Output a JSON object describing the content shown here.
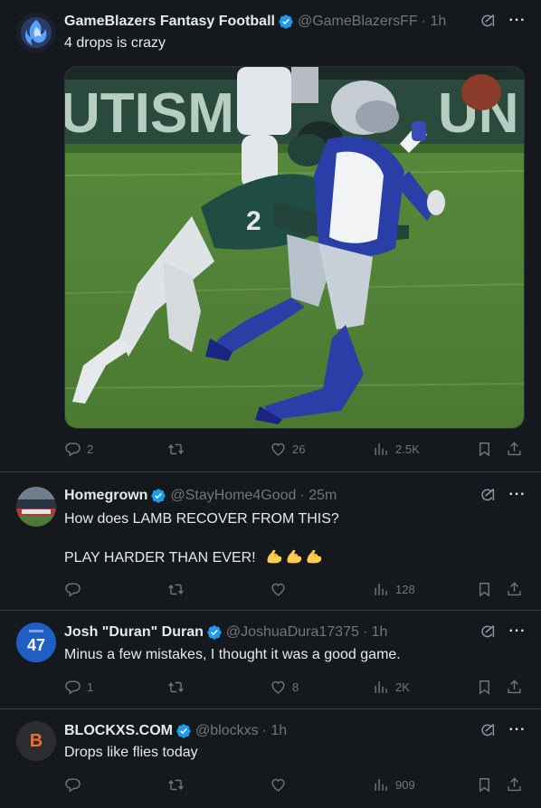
{
  "posts": [
    {
      "name": "GameBlazers Fantasy Football",
      "handle": "@GameBlazersFF",
      "time": "· 1h",
      "text": "4 drops is crazy",
      "replies": "2",
      "reposts": "",
      "likes": "26",
      "views": "2.5K"
    },
    {
      "name": "Homegrown",
      "handle": "@StayHome4Good",
      "time": "· 25m",
      "text_line1": "How does LAMB RECOVER FROM THIS?",
      "text_line2": "PLAY HARDER THAN EVER!",
      "emoji": [
        "flexed-biceps",
        "flexed-biceps",
        "flexed-biceps"
      ],
      "replies": "",
      "reposts": "",
      "likes": "",
      "views": "128"
    },
    {
      "name": "Josh \"Duran\" Duran",
      "handle": "@JoshuaDura17375",
      "time": "· 1h",
      "text": "Minus a few mistakes, I thought it was a good game.",
      "avatar_text": "47",
      "replies": "1",
      "reposts": "",
      "likes": "8",
      "views": "2K"
    },
    {
      "name": "BLOCKXS.COM",
      "handle": "@blockxs",
      "time": "· 1h",
      "text": "Drops like flies today",
      "avatar_text": "B",
      "replies": "",
      "reposts": "",
      "likes": "",
      "views": "909"
    }
  ],
  "media": {
    "banner_left": "UTISM",
    "banner_right": "UN",
    "jersey_number": "2"
  },
  "colors": {
    "background": "#15181c",
    "text": "#e7e9ea",
    "muted": "#71767b",
    "verified": "#1d9bf0",
    "divider": "#3a3f45"
  }
}
